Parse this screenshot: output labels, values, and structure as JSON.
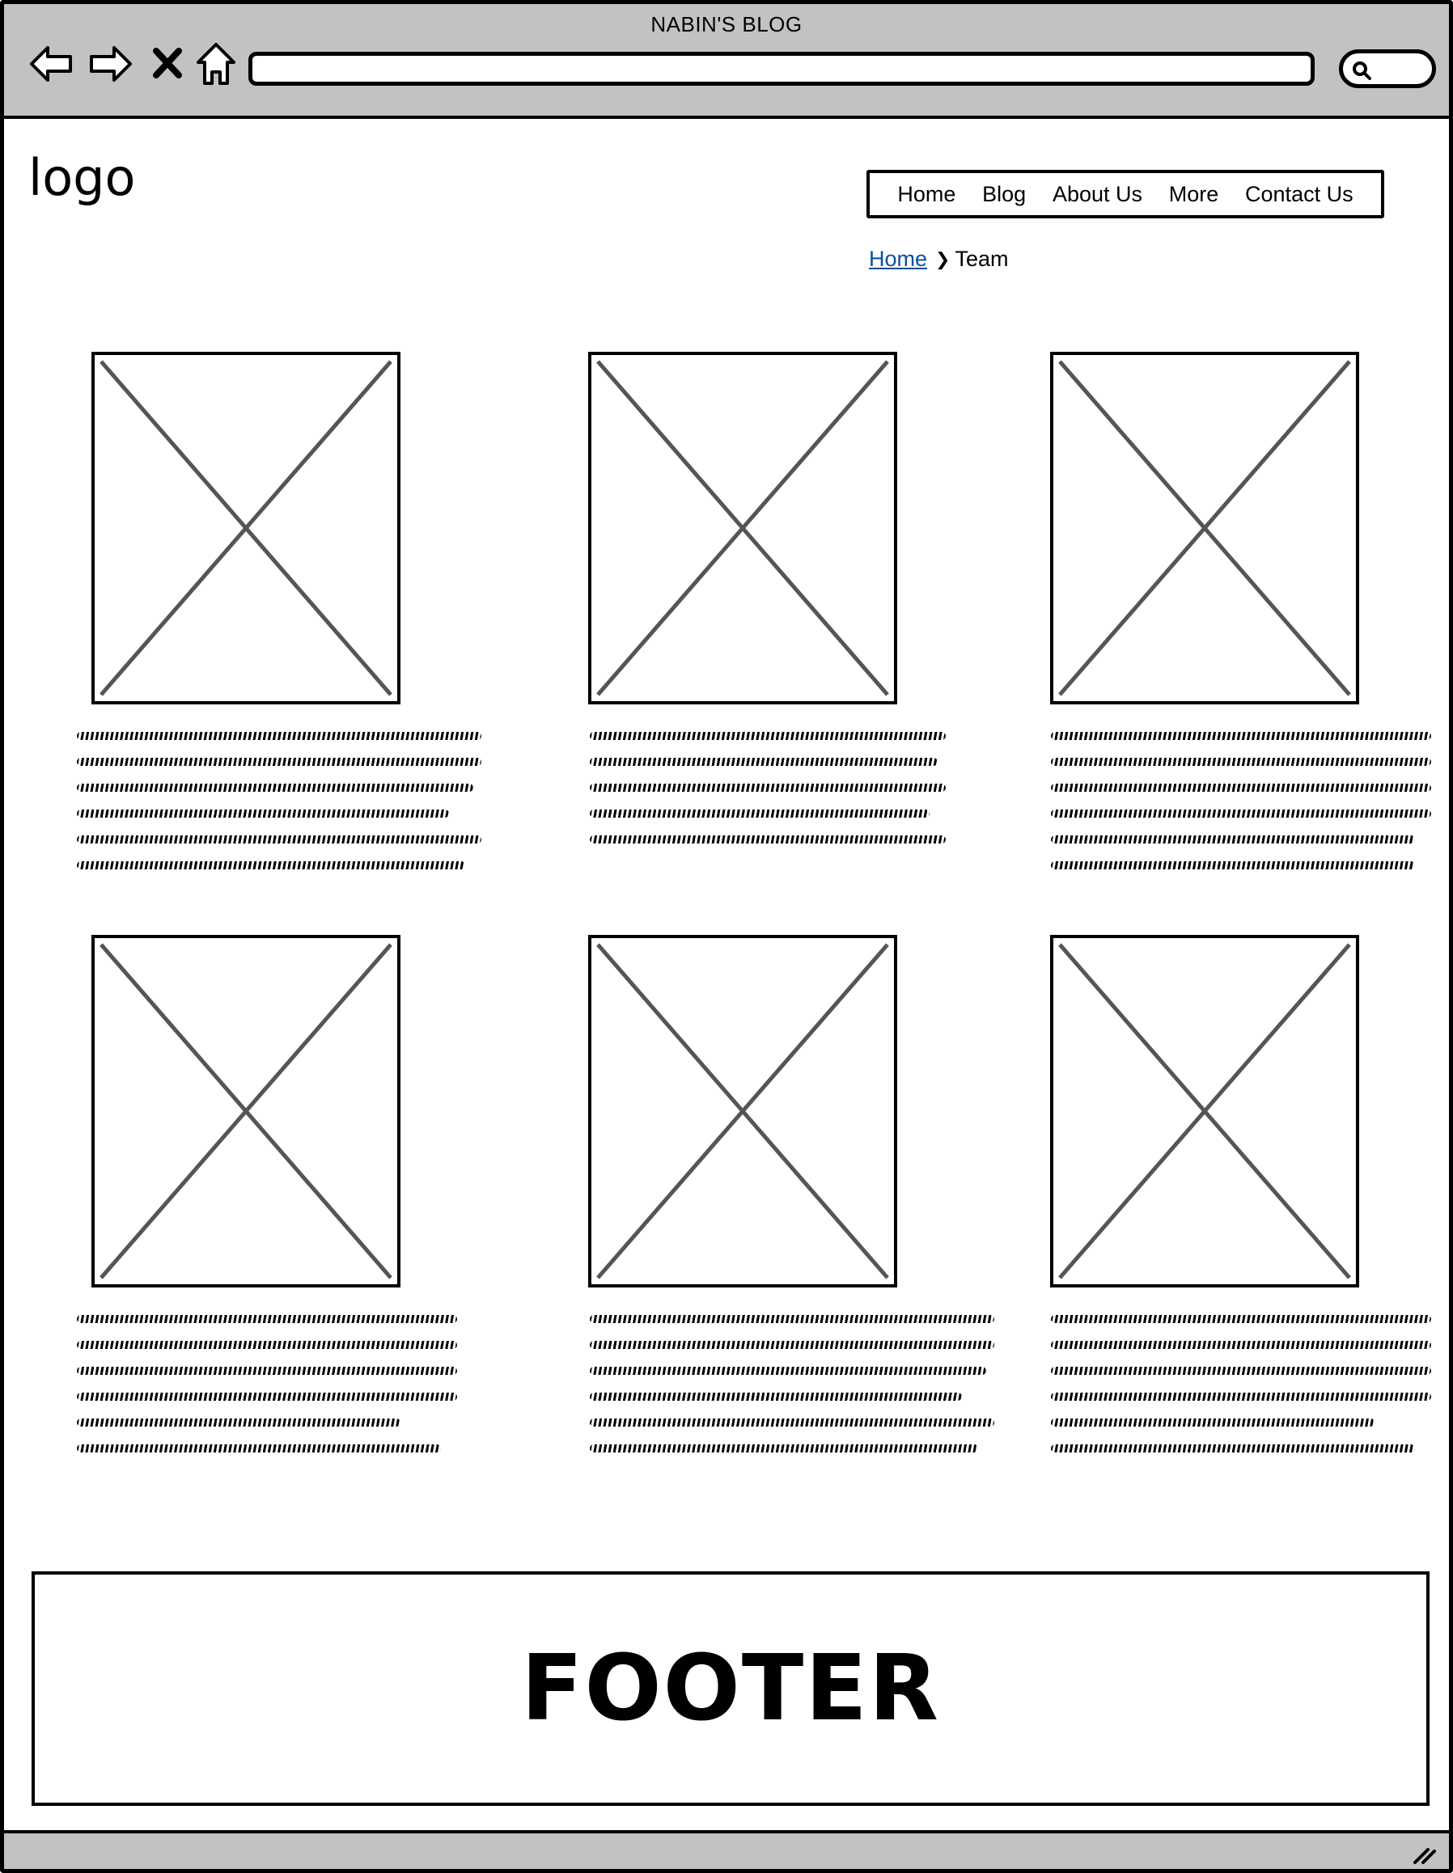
{
  "browser": {
    "title": "NABIN'S BLOG",
    "icons": [
      "back-arrow-icon",
      "forward-arrow-icon",
      "close-icon",
      "home-icon",
      "search-icon"
    ],
    "url": ""
  },
  "header": {
    "logo": "logo",
    "nav": [
      "Home",
      "Blog",
      "About Us",
      "More",
      "Contact Us"
    ]
  },
  "breadcrumb": {
    "link": "Home",
    "current": "Team"
  },
  "cards": [
    {
      "image": "image-placeholder",
      "text_lines": 6
    },
    {
      "image": "image-placeholder",
      "text_lines": 5
    },
    {
      "image": "image-placeholder",
      "text_lines": 6
    },
    {
      "image": "image-placeholder",
      "text_lines": 6
    },
    {
      "image": "image-placeholder",
      "text_lines": 6
    },
    {
      "image": "image-placeholder",
      "text_lines": 6
    }
  ],
  "footer": {
    "label": "FOOTER"
  },
  "colors": {
    "chrome": "#c2c2c2",
    "link": "#0b4fa0",
    "placeholder_stroke": "#555555"
  }
}
